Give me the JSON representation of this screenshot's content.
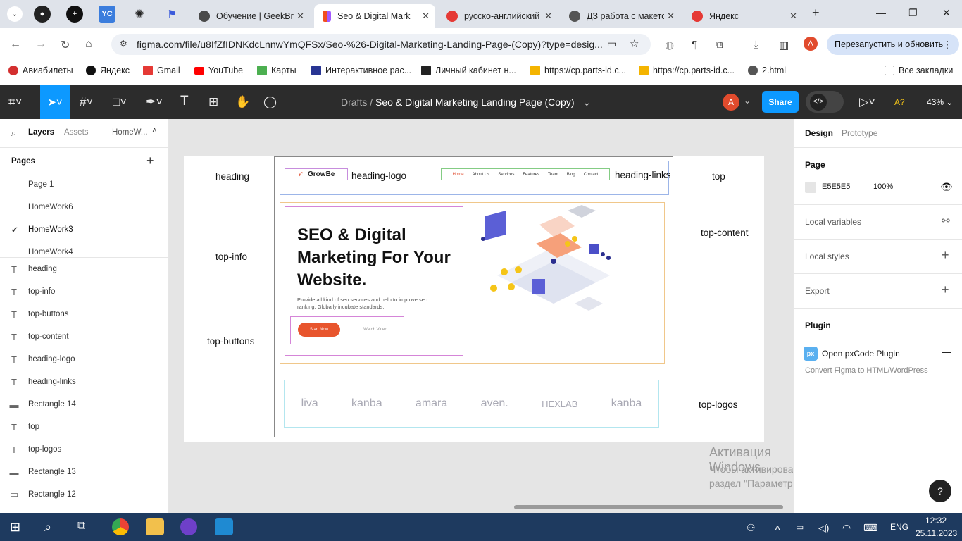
{
  "browser": {
    "tabs": [
      {
        "title": "Обучение | GeekBrains",
        "favicon_color": "#4a4a4a"
      },
      {
        "title": "Seo & Digital Marketing",
        "favicon_color": "#f24e1e",
        "active": true
      },
      {
        "title": "русско-английский",
        "favicon_color": "#e53935"
      },
      {
        "title": "ДЗ работа с макетом",
        "favicon_color": "#555555"
      },
      {
        "title": "Яндекс",
        "favicon_color": "#e53935"
      }
    ],
    "address": "figma.com/file/u8IfZfIDNKdcLnnwYmQFSx/Seo-%26-Digital-Marketing-Landing-Page-(Copy)?type=desig...",
    "relaunch_label": "Перезапустить и обновить",
    "profile_initial": "A",
    "bookmarks": [
      {
        "label": "Авиабилеты",
        "color": "#d32f2f"
      },
      {
        "label": "Яндекс",
        "color": "#111111"
      },
      {
        "label": "Gmail",
        "color": "#e53935"
      },
      {
        "label": "YouTube",
        "color": "#ff0000"
      },
      {
        "label": "Карты",
        "color": "#4caf50"
      },
      {
        "label": "Интерактивное рас...",
        "color": "#283593"
      },
      {
        "label": "Личный кабинет н...",
        "color": "#222222"
      },
      {
        "label": "https://cp.parts-id.c...",
        "color": "#f4b400"
      },
      {
        "label": "https://cp.parts-id.c...",
        "color": "#f4b400"
      },
      {
        "label": "2.html",
        "color": "#555555"
      }
    ],
    "all_bookmarks": "Все закладки"
  },
  "figma": {
    "breadcrumb_root": "Drafts",
    "file_name": "Seo & Digital Marketing Landing Page (Copy)",
    "share_label": "Share",
    "zoom": "43%",
    "avatar_initial": "A",
    "left_tabs": {
      "layers": "Layers",
      "assets": "Assets",
      "page": "HomeW..."
    },
    "pages_title": "Pages",
    "pages": [
      "Page 1",
      "HomeWork6",
      "HomeWork3",
      "HomeWork4"
    ],
    "current_page": "HomeWork3",
    "layers": [
      {
        "name": "heading",
        "kind": "text"
      },
      {
        "name": "top-info",
        "kind": "text"
      },
      {
        "name": "top-buttons",
        "kind": "text"
      },
      {
        "name": "top-content",
        "kind": "text"
      },
      {
        "name": "heading-logo",
        "kind": "text"
      },
      {
        "name": "heading-links",
        "kind": "text"
      },
      {
        "name": "Rectangle 14",
        "kind": "rect"
      },
      {
        "name": "top",
        "kind": "text"
      },
      {
        "name": "top-logos",
        "kind": "text"
      },
      {
        "name": "Rectangle 13",
        "kind": "rect"
      },
      {
        "name": "Rectangle 12",
        "kind": "rect"
      }
    ],
    "right": {
      "tabs": {
        "design": "Design",
        "prototype": "Prototype"
      },
      "page_title": "Page",
      "page_color": "E5E5E5",
      "page_opacity": "100%",
      "local_variables": "Local variables",
      "local_styles": "Local styles",
      "export": "Export",
      "plugin_title": "Plugin",
      "plugin_name": "Open pxCode Plugin",
      "plugin_desc": "Convert Figma to HTML/WordPress"
    },
    "canvas_labels": {
      "heading": "heading",
      "top_info": "top-info",
      "top_buttons": "top-buttons",
      "heading_logo": "heading-logo",
      "heading_links": "heading-links",
      "top": "top",
      "top_content": "top-content",
      "top_logos": "top-logos"
    },
    "mock": {
      "logo": "GrowBe",
      "nav": [
        "Home",
        "About Us",
        "Services",
        "Features",
        "Team",
        "Blog",
        "Contact"
      ],
      "hero_title": "SEO & Digital Marketing For Your Website.",
      "hero_text": "Provide all kind of seo services and help to improve seo ranking. Globally incubate standards.",
      "btn_start": "Start Now",
      "btn_watch": "Watch Video",
      "logos": [
        "liva",
        "kanba",
        "amara",
        "aven.",
        "HEXLAB",
        "kanba"
      ]
    },
    "watermark_title": "Активация Windows",
    "watermark_text": "Чтобы активировать Windows, перейдите в раздел \"Параметры\".",
    "help": "?"
  },
  "taskbar": {
    "lang": "ENG",
    "time": "12:32",
    "date": "25.11.2023"
  }
}
